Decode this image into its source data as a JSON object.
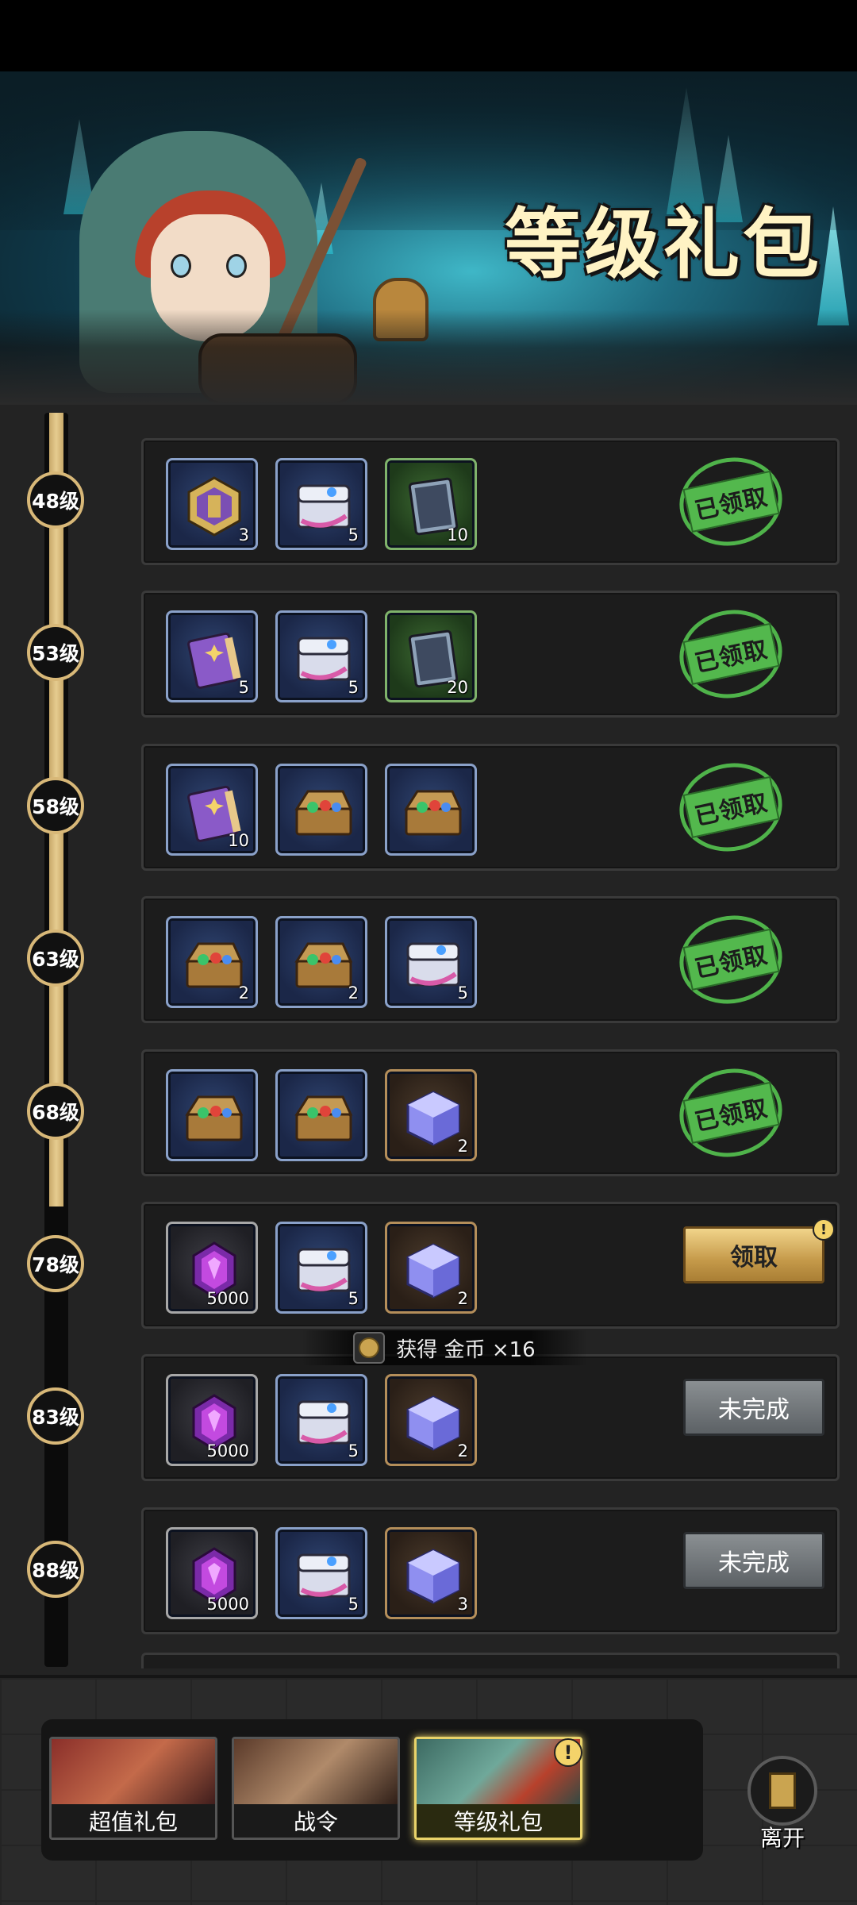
{
  "banner": {
    "title": "等级礼包"
  },
  "rows": [
    {
      "level": "48级",
      "items": [
        {
          "icon": "rune-medal-icon",
          "qty": "3"
        },
        {
          "icon": "treasure-chest-icon",
          "qty": "5"
        },
        {
          "icon": "blueprint-card-icon",
          "qty": "10"
        }
      ],
      "state": "已领取"
    },
    {
      "level": "53级",
      "items": [
        {
          "icon": "spell-book-icon",
          "qty": "5"
        },
        {
          "icon": "treasure-chest-icon",
          "qty": "5"
        },
        {
          "icon": "blueprint-card-icon",
          "qty": "20"
        }
      ],
      "state": "已领取"
    },
    {
      "level": "58级",
      "items": [
        {
          "icon": "spell-book-icon",
          "qty": "10"
        },
        {
          "icon": "gem-chest-icon",
          "qty": ""
        },
        {
          "icon": "gem-chest-icon",
          "qty": ""
        }
      ],
      "state": "已领取"
    },
    {
      "level": "63级",
      "items": [
        {
          "icon": "gem-chest-icon",
          "qty": "2"
        },
        {
          "icon": "gem-chest-icon",
          "qty": "2"
        },
        {
          "icon": "treasure-chest-icon",
          "qty": "5"
        }
      ],
      "state": "已领取"
    },
    {
      "level": "68级",
      "items": [
        {
          "icon": "gem-chest-icon",
          "qty": ""
        },
        {
          "icon": "gem-chest-icon",
          "qty": ""
        },
        {
          "icon": "crystal-cube-icon",
          "qty": "2"
        }
      ],
      "state": "已领取"
    },
    {
      "level": "78级",
      "items": [
        {
          "icon": "purple-crystal-icon",
          "qty": "5000"
        },
        {
          "icon": "treasure-chest-icon",
          "qty": "5"
        },
        {
          "icon": "crystal-cube-icon",
          "qty": "2"
        }
      ],
      "state": "领取"
    },
    {
      "level": "83级",
      "items": [
        {
          "icon": "purple-crystal-icon",
          "qty": "5000"
        },
        {
          "icon": "treasure-chest-icon",
          "qty": "5"
        },
        {
          "icon": "crystal-cube-icon",
          "qty": "2"
        }
      ],
      "state": "未完成"
    },
    {
      "level": "88级",
      "items": [
        {
          "icon": "purple-crystal-icon",
          "qty": "5000"
        },
        {
          "icon": "treasure-chest-icon",
          "qty": "5"
        },
        {
          "icon": "crystal-cube-icon",
          "qty": "3"
        }
      ],
      "state": "未完成"
    }
  ],
  "alert_mark": "!",
  "toast": {
    "text": "获得 金币 ×16"
  },
  "tabs": [
    {
      "label": "超值礼包"
    },
    {
      "label": "战令"
    },
    {
      "label": "等级礼包"
    }
  ],
  "leave": {
    "label": "离开"
  }
}
